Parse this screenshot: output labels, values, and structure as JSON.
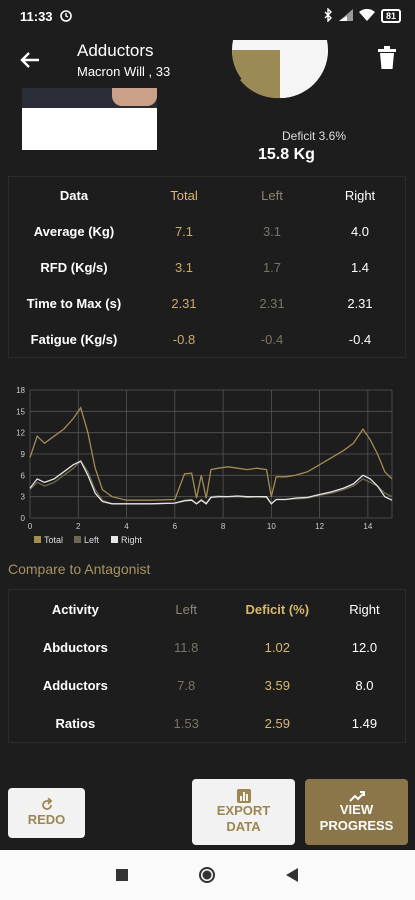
{
  "status": {
    "time": "11:33",
    "battery": "81"
  },
  "header": {
    "title": "Adductors",
    "subtitle": "Macron Will , 33"
  },
  "summary": {
    "deficit_label": "Deficit 3.6%",
    "total_value": "15.8 Kg"
  },
  "table1": {
    "headers": [
      "Data",
      "Total",
      "Left",
      "Right"
    ],
    "rows": [
      [
        "Average (Kg)",
        "7.1",
        "3.1",
        "4.0"
      ],
      [
        "RFD (Kg/s)",
        "3.1",
        "1.7",
        "1.4"
      ],
      [
        "Time to Max (s)",
        "2.31",
        "2.31",
        "2.31"
      ],
      [
        "Fatigue (Kg/s)",
        "-0.8",
        "-0.4",
        "-0.4"
      ]
    ]
  },
  "chart_data": {
    "type": "line",
    "x": [
      0,
      0.3,
      0.6,
      1,
      1.4,
      1.8,
      2.1,
      2.4,
      2.7,
      3,
      3.4,
      4,
      5,
      6,
      6.4,
      6.7,
      6.9,
      7.1,
      7.3,
      7.5,
      7.8,
      8.2,
      8.6,
      9,
      9.4,
      9.8,
      10.0,
      10.2,
      10.6,
      11,
      11.5,
      12,
      12.5,
      13,
      13.4,
      13.8,
      14.1,
      14.4,
      14.7,
      15
    ],
    "series": [
      {
        "name": "Total",
        "color": "#a28c52",
        "values": [
          8.5,
          11.5,
          10.5,
          11.5,
          12.5,
          14.0,
          15.5,
          12.0,
          7.0,
          4.0,
          3.0,
          2.5,
          2.5,
          2.6,
          6.2,
          6.3,
          2.8,
          6.0,
          2.8,
          6.8,
          7.0,
          7.2,
          7.0,
          6.8,
          7.0,
          6.8,
          3.0,
          5.8,
          5.8,
          6.0,
          6.5,
          7.5,
          8.5,
          9.5,
          10.5,
          12.5,
          11.0,
          9.0,
          6.5,
          5.5
        ]
      },
      {
        "name": "Left",
        "color": "#6e6651",
        "values": [
          4.0,
          5.0,
          4.5,
          5.0,
          6.0,
          7.0,
          8.0,
          6.5,
          4.0,
          2.5,
          2.0,
          2.0,
          2.0,
          2.1,
          2.5,
          2.6,
          2.0,
          2.6,
          2.1,
          3.0,
          3.1,
          3.0,
          3.0,
          2.9,
          3.0,
          2.9,
          2.0,
          2.6,
          2.6,
          2.7,
          2.8,
          3.2,
          3.5,
          4.0,
          4.5,
          5.5,
          5.0,
          4.5,
          3.5,
          3.0
        ]
      },
      {
        "name": "Right",
        "color": "#e5e5e5",
        "values": [
          4.2,
          5.5,
          5.0,
          5.5,
          6.5,
          7.5,
          8.0,
          6.0,
          3.5,
          2.3,
          2.0,
          2.0,
          2.0,
          2.1,
          2.4,
          2.5,
          2.0,
          2.5,
          2.0,
          2.9,
          3.0,
          3.0,
          3.1,
          3.0,
          3.0,
          3.0,
          2.0,
          2.6,
          2.6,
          2.8,
          2.9,
          3.3,
          3.7,
          4.2,
          4.8,
          6.0,
          5.5,
          4.5,
          3.0,
          2.5
        ]
      }
    ],
    "xticks": [
      0,
      2,
      4,
      6,
      8,
      10,
      12,
      14
    ],
    "yticks": [
      0,
      3,
      6,
      9,
      12,
      15,
      18
    ],
    "xlim": [
      0,
      15
    ],
    "ylim": [
      0,
      18
    ],
    "grid": true,
    "legend": "bottom-left",
    "legend_labels": [
      "Total",
      "Left",
      "Right"
    ]
  },
  "compare": {
    "title": "Compare to Antagonist",
    "headers": [
      "Activity",
      "Left",
      "Deficit (%)",
      "Right"
    ],
    "rows": [
      [
        "Abductors",
        "11.8",
        "1.02",
        "12.0"
      ],
      [
        "Adductors",
        "7.8",
        "3.59",
        "8.0"
      ],
      [
        "Ratios",
        "1.53",
        "2.59",
        "1.49"
      ]
    ]
  },
  "buttons": {
    "redo": "REDO",
    "export_1": "EXPORT",
    "export_2": "DATA",
    "progress_1": "VIEW",
    "progress_2": "PROGRESS"
  },
  "colors": {
    "accent": "#d7b86f",
    "background": "#1d1d1d",
    "progress_button": "#8a7648"
  }
}
